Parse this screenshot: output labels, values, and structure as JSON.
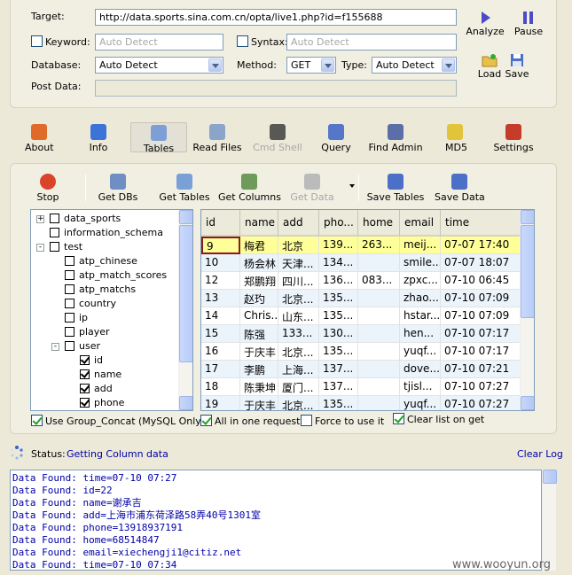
{
  "form": {
    "target_label": "Target:",
    "target_value": "http://data.sports.sina.com.cn/opta/live1.php?id=f155688",
    "keyword_label": "Keyword:",
    "keyword_value": "Auto Detect",
    "syntax_label": "Syntax:",
    "syntax_value": "Auto Detect",
    "database_label": "Database:",
    "database_value": "Auto Detect",
    "method_label": "Method:",
    "method_value": "GET",
    "type_label": "Type:",
    "type_value": "Auto Detect",
    "postdata_label": "Post Data:",
    "postdata_value": ""
  },
  "actions": {
    "analyze": "Analyze",
    "pause": "Pause",
    "load": "Load",
    "save": "Save"
  },
  "main_toolbar": [
    {
      "label": "About",
      "icon": "about-icon"
    },
    {
      "label": "Info",
      "icon": "info-icon"
    },
    {
      "label": "Tables",
      "icon": "tables-icon"
    },
    {
      "label": "Read Files",
      "icon": "read-files-icon"
    },
    {
      "label": "Cmd Shell",
      "icon": "cmd-shell-icon"
    },
    {
      "label": "Query",
      "icon": "query-icon"
    },
    {
      "label": "Find Admin",
      "icon": "find-admin-icon"
    },
    {
      "label": "MD5",
      "icon": "md5-icon"
    },
    {
      "label": "Settings",
      "icon": "settings-icon"
    }
  ],
  "sub_toolbar": [
    {
      "label": "Stop",
      "icon": "stop-icon"
    },
    {
      "label": "Get DBs",
      "icon": "database-icon"
    },
    {
      "label": "Get Tables",
      "icon": "table-icon"
    },
    {
      "label": "Get Columns",
      "icon": "columns-icon"
    },
    {
      "label": "Get Data",
      "icon": "data-icon"
    },
    {
      "label": "Save Tables",
      "icon": "save-tables-icon"
    },
    {
      "label": "Save Data",
      "icon": "save-data-icon"
    }
  ],
  "tree": [
    {
      "label": "data_sports",
      "level": 0,
      "expander": "+",
      "checked": false
    },
    {
      "label": "information_schema",
      "level": 0,
      "expander": "",
      "checked": false
    },
    {
      "label": "test",
      "level": 0,
      "expander": "-",
      "checked": false
    },
    {
      "label": "atp_chinese",
      "level": 1,
      "expander": "",
      "checked": false
    },
    {
      "label": "atp_match_scores",
      "level": 1,
      "expander": "",
      "checked": false
    },
    {
      "label": "atp_matchs",
      "level": 1,
      "expander": "",
      "checked": false
    },
    {
      "label": "country",
      "level": 1,
      "expander": "",
      "checked": false
    },
    {
      "label": "ip",
      "level": 1,
      "expander": "",
      "checked": false
    },
    {
      "label": "player",
      "level": 1,
      "expander": "",
      "checked": false
    },
    {
      "label": "user",
      "level": 1,
      "expander": "-",
      "checked": false
    },
    {
      "label": "id",
      "level": 2,
      "expander": "",
      "checked": true
    },
    {
      "label": "name",
      "level": 2,
      "expander": "",
      "checked": true
    },
    {
      "label": "add",
      "level": 2,
      "expander": "",
      "checked": true
    },
    {
      "label": "phone",
      "level": 2,
      "expander": "",
      "checked": true
    }
  ],
  "grid": {
    "columns": [
      "id",
      "name",
      "add",
      "pho...",
      "home",
      "email",
      "time"
    ],
    "rows": [
      [
        "9",
        "梅君",
        "北京",
        "139...",
        "263...",
        "meij...",
        "07-07 17:40"
      ],
      [
        "10",
        "杨会林",
        "天津...",
        "134...",
        "",
        "smile...",
        "07-07 18:07"
      ],
      [
        "12",
        "郑鹏翔",
        "四川...",
        "136...",
        "083...",
        "zpxc...",
        "07-10 06:45"
      ],
      [
        "13",
        "赵玓",
        "北京...",
        "135...",
        "",
        "zhao...",
        "07-10 07:09"
      ],
      [
        "14",
        "Chris...",
        "山东...",
        "135...",
        "",
        "hstar...",
        "07-10 07:09"
      ],
      [
        "15",
        "陈强",
        "133...",
        "130...",
        "",
        "hen...",
        "07-10 07:17"
      ],
      [
        "16",
        "于庆丰",
        "北京...",
        "135...",
        "",
        "yuqf...",
        "07-10 07:17"
      ],
      [
        "17",
        "李鹏",
        "上海...",
        "137...",
        "",
        "dove...",
        "07-10 07:21"
      ],
      [
        "18",
        "陈秉坤",
        "厦门...",
        "137...",
        "",
        "tjisl...",
        "07-10 07:27"
      ],
      [
        "19",
        "于庆丰",
        "北京...",
        "135...",
        "",
        "yuqf...",
        "07-10 07:27"
      ]
    ]
  },
  "options": {
    "group_concat": "Use Group_Concat (MySQL Only)",
    "all_in_one": "All in one request.",
    "force": "Force to use it",
    "clear_list": "Clear list on get"
  },
  "status": {
    "label": "Status:",
    "value": "Getting Column data",
    "clear_log": "Clear Log"
  },
  "log": [
    "Data Found: time=07-10 07:27",
    "Data Found: id=22",
    "Data Found: name=谢承吉",
    "Data Found: add=上海市浦东荷泽路58弄40号1301室",
    "Data Found: phone=13918937191",
    "Data Found: home=68514847",
    "Data Found: email=xiechengji1@citiz.net",
    "Data Found: time=07-10 07:34"
  ],
  "watermark": "www.wooyun.org",
  "colors": {
    "selected_row": "#ffff99",
    "alt_row": "#ebf3fb",
    "status_blue": "#0000a8"
  }
}
